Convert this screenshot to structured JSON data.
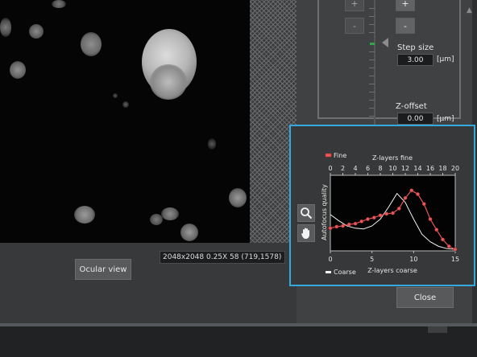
{
  "colors": {
    "accent": "#34aadc",
    "fine_series": "#e8575a",
    "coarse_series": "#f2f2f2",
    "marker_green": "#2ea84a"
  },
  "stepper": {
    "up_left": "+",
    "down_left": "-",
    "up_right": "+",
    "down_right": "-"
  },
  "step_size": {
    "label": "Step size",
    "value": "3.00",
    "unit": "[µm]"
  },
  "z_offset": {
    "label": "Z-offset",
    "value": "0.00",
    "unit": "[µm]"
  },
  "image_info": "2048x2048 0.25X 58    (719,1578)",
  "buttons": {
    "ocular_view": "Ocular view",
    "close": "Close"
  },
  "icons": {
    "zoom": "magnifier-icon",
    "pan": "hand-icon"
  },
  "chart_data": {
    "type": "line",
    "ylabel": "Autofocus quality",
    "x_top": {
      "label": "Z-layers fine",
      "range": [
        0,
        20
      ],
      "ticks": [
        "0",
        "2",
        "4",
        "6",
        "8",
        "10",
        "12",
        "14",
        "16",
        "18",
        "20"
      ]
    },
    "x_bottom": {
      "label": "Z-layers coarse",
      "range": [
        0,
        15
      ],
      "ticks": [
        "0",
        "5",
        "10",
        "15"
      ]
    },
    "y_range": [
      0,
      1
    ],
    "legend": [
      "Fine",
      "Coarse"
    ],
    "series": [
      {
        "name": "Fine",
        "axis": "top",
        "markers": true,
        "x": [
          0,
          1,
          2,
          3,
          4,
          5,
          6,
          7,
          8,
          9,
          10,
          11,
          12,
          13,
          14,
          15,
          16,
          17,
          18,
          19,
          20
        ],
        "y": [
          0.3,
          0.32,
          0.33,
          0.35,
          0.36,
          0.39,
          0.42,
          0.44,
          0.47,
          0.49,
          0.5,
          0.56,
          0.7,
          0.8,
          0.75,
          0.62,
          0.42,
          0.28,
          0.15,
          0.06,
          0.02
        ]
      },
      {
        "name": "Coarse",
        "axis": "bottom",
        "markers": false,
        "x": [
          0,
          1,
          2,
          3,
          4,
          5,
          6,
          7,
          8,
          9,
          10,
          11,
          12,
          13,
          14,
          15
        ],
        "y": [
          0.48,
          0.4,
          0.33,
          0.3,
          0.29,
          0.33,
          0.42,
          0.58,
          0.76,
          0.64,
          0.42,
          0.22,
          0.12,
          0.06,
          0.03,
          0.02
        ]
      }
    ]
  }
}
